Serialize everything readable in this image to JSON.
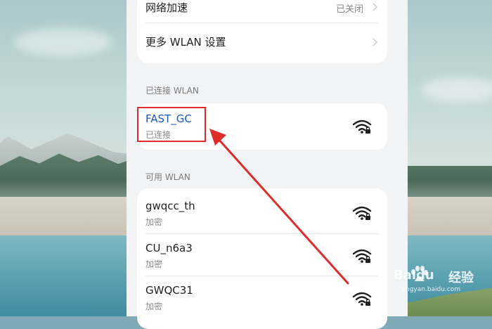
{
  "settings": {
    "network_accel": {
      "label": "网络加速",
      "value": "已关闭"
    },
    "more_wlan": {
      "label": "更多 WLAN 设置"
    }
  },
  "connected": {
    "section_label": "已连接 WLAN",
    "network": {
      "ssid": "FAST_GC",
      "status": "已连接",
      "icon": "wifi-locked-icon"
    }
  },
  "available": {
    "section_label": "可用 WLAN",
    "networks": [
      {
        "ssid": "gwqcc_th",
        "status": "加密",
        "icon": "wifi-locked-icon"
      },
      {
        "ssid": "CU_n6a3",
        "status": "加密",
        "icon": "wifi-locked-icon"
      },
      {
        "ssid": "GWQC31",
        "status": "加密",
        "icon": "wifi-locked-icon"
      }
    ]
  },
  "annotation": {
    "color": "#e02b2b"
  },
  "watermark": {
    "brand": "Baidu",
    "product": "经验",
    "url": "jingyan.baidu.com"
  },
  "colors": {
    "accent": "#1757c2",
    "panel_bg": "#f2f3f5",
    "card_bg": "#ffffff"
  }
}
